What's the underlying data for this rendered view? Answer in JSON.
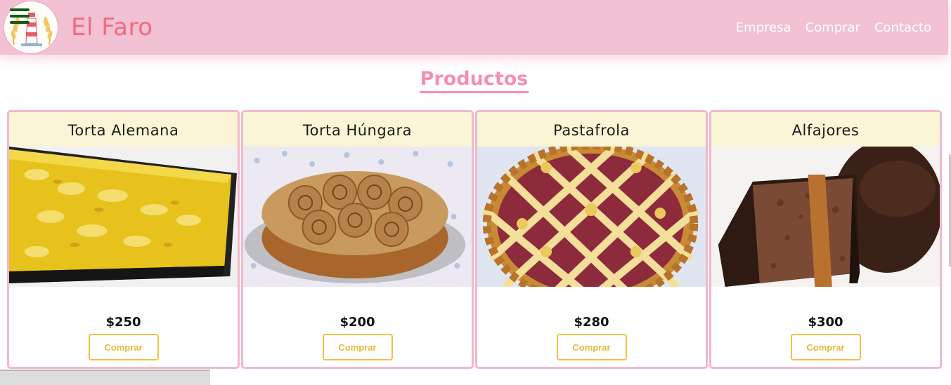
{
  "brand": {
    "name": "El Faro"
  },
  "nav": {
    "links": [
      "Empresa",
      "Comprar",
      "Contacto"
    ]
  },
  "section": {
    "title": "Productos"
  },
  "products": [
    {
      "name": "Torta Alemana",
      "price": "$250",
      "button": "Comprar",
      "image_icon": "torta-alemana-photo"
    },
    {
      "name": "Torta Húngara",
      "price": "$200",
      "button": "Comprar",
      "image_icon": "torta-hungara-photo"
    },
    {
      "name": "Pastafrola",
      "price": "$280",
      "button": "Comprar",
      "image_icon": "pastafrola-photo"
    },
    {
      "name": "Alfajores",
      "price": "$300",
      "button": "Comprar",
      "image_icon": "alfajores-photo"
    }
  ],
  "colors": {
    "navbar_bg": "#f2c1d3",
    "brand_text": "#f26b7f",
    "section_title": "#f48fb3",
    "card_border": "#f2b8cc",
    "card_title_bg": "#faf5d6",
    "button_accent": "#f0c146"
  }
}
